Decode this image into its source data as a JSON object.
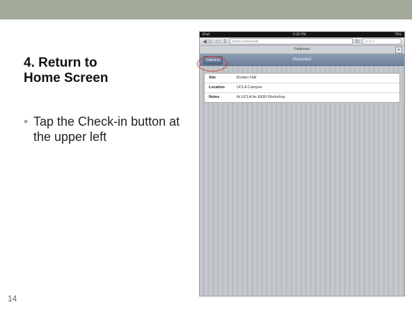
{
  "slide": {
    "title_line1": "4. Return to",
    "title_line2": "Home Screen",
    "bullet": "Tap the Check-in button at the upper left",
    "bullet_marker": "•",
    "number": "14"
  },
  "device": {
    "status": {
      "carrier": "iPad",
      "time": "5:26 PM",
      "battery": "76%"
    },
    "toolbar": {
      "url": "fieldrecords/results",
      "search_placeholder": "Search"
    },
    "tab_title": "Fieldnotes",
    "new_tab_label": "+",
    "navbar": {
      "checkin_label": "Check-in",
      "title": "Recorded"
    },
    "record": [
      {
        "label": "Site",
        "value": "Boelter Hall"
      },
      {
        "label": "Location",
        "value": "UCLA Campus"
      },
      {
        "label": "Notes",
        "value": "At UCLA for EERI Workshop"
      }
    ]
  },
  "colors": {
    "band": "#a2aa9a",
    "highlight": "#d23a2f",
    "navbar": "#7a8ca8"
  }
}
